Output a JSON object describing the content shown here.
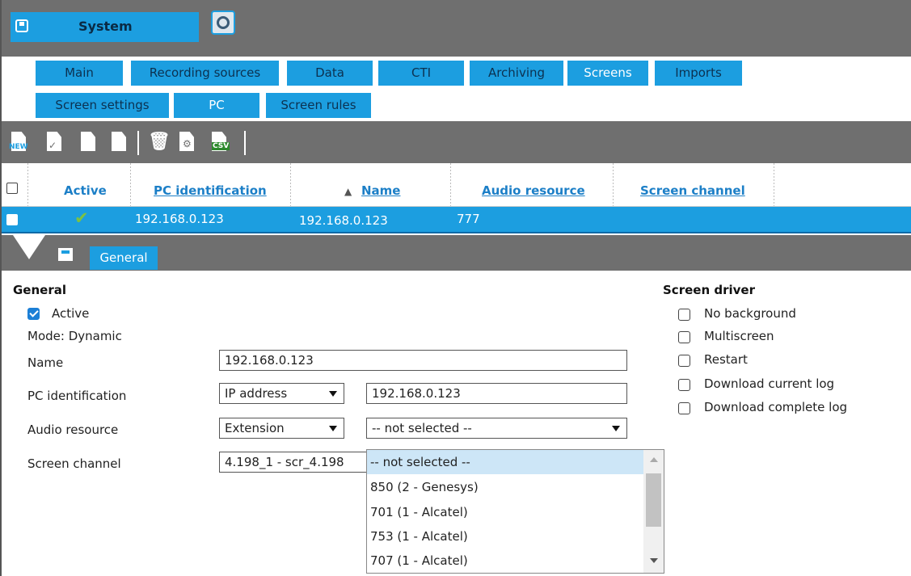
{
  "system": {
    "title": "System"
  },
  "tabs_main": [
    "Main",
    "Recording sources",
    "Data",
    "CTI",
    "Archiving",
    "Screens",
    "Imports"
  ],
  "tabs_sub": [
    "Screen settings",
    "PC",
    "Screen rules"
  ],
  "toolbar": {
    "new_label": "NEW",
    "csv_label": "CSV"
  },
  "grid": {
    "headers": {
      "active": "Active",
      "pc_identification": "PC identification",
      "name": "Name",
      "audio_resource": "Audio resource",
      "screen_channel": "Screen channel"
    },
    "sort_indicator": "▲",
    "row": {
      "active_mark": "✔",
      "pc_identification": "192.168.0.123",
      "name": "192.168.0.123",
      "audio_resource": "777"
    }
  },
  "detail": {
    "tab_label": "General",
    "general": {
      "title": "General",
      "active_label": "Active",
      "mode_text": "Mode: Dynamic",
      "name_label": "Name",
      "name_value": "192.168.0.123",
      "pc_id_label": "PC identification",
      "pc_id_type": "IP address",
      "pc_id_value": "192.168.0.123",
      "audio_label": "Audio resource",
      "audio_type": "Extension",
      "audio_value": "-- not selected --",
      "screen_channel_label": "Screen channel",
      "screen_channel_value": "4.198_1 - scr_4.198"
    },
    "screen_driver": {
      "title": "Screen driver",
      "options": [
        "No background",
        "Multiscreen",
        "Restart",
        "Download current log",
        "Download complete log"
      ]
    },
    "audio_dropdown": [
      "-- not selected --",
      "850 (2 - Genesys)",
      "701 (1 - Alcatel)",
      "753 (1 - Alcatel)",
      "707 (1 - Alcatel)"
    ]
  },
  "colors": {
    "accent": "#1c9ee0",
    "bar": "#6f6f6f",
    "link": "#1c7fc7",
    "check_green": "#7cc242"
  }
}
